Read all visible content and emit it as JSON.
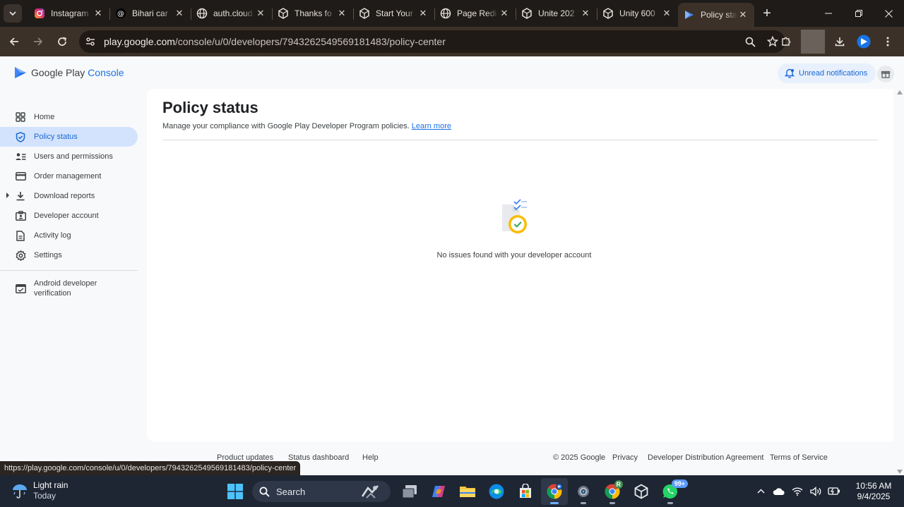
{
  "browser": {
    "tabs": [
      {
        "title": "Instagram",
        "icon": "instagram-icon",
        "active": false
      },
      {
        "title": "Bihari car",
        "icon": "threads-icon",
        "active": false
      },
      {
        "title": "auth.cloud",
        "icon": "globe-icon",
        "active": false
      },
      {
        "title": "Thanks fo",
        "icon": "unity-icon",
        "active": false
      },
      {
        "title": "Start Your",
        "icon": "unity-icon",
        "active": false
      },
      {
        "title": "Page Redi",
        "icon": "globe-icon",
        "active": false
      },
      {
        "title": "Unite 202",
        "icon": "unity-icon",
        "active": false
      },
      {
        "title": "Unity 600",
        "icon": "unity-icon",
        "active": false
      },
      {
        "title": "Policy stat",
        "icon": "play-console-icon",
        "active": true
      }
    ],
    "url_domain": "play.google.com",
    "url_path": "/console/u/0/developers/7943262549569181483/policy-center",
    "status_url": "https://play.google.com/console/u/0/developers/7943262549569181483/policy-center"
  },
  "header": {
    "logo_text_a": "Google Play",
    "logo_text_b": " Console",
    "notifications_label": "Unread notifications"
  },
  "sidebar": {
    "items": [
      {
        "label": "Home",
        "icon": "home-grid-icon"
      },
      {
        "label": "Policy status",
        "icon": "shield-check-icon"
      },
      {
        "label": "Users and permissions",
        "icon": "users-icon"
      },
      {
        "label": "Order management",
        "icon": "credit-card-icon"
      },
      {
        "label": "Download reports",
        "icon": "download-icon"
      },
      {
        "label": "Developer account",
        "icon": "id-badge-icon"
      },
      {
        "label": "Activity log",
        "icon": "document-icon"
      },
      {
        "label": "Settings",
        "icon": "gear-icon"
      },
      {
        "label": "Android developer verification",
        "icon": "verification-icon"
      }
    ]
  },
  "main": {
    "title": "Policy status",
    "description": "Manage your compliance with Google Play Developer Program policies.",
    "learn_more": "Learn more",
    "empty_message": "No issues found with your developer account"
  },
  "footer": {
    "links": [
      "Product updates",
      "Status dashboard",
      "Help"
    ],
    "copyright": "© 2025 Google",
    "legal": [
      "Privacy",
      "Developer Distribution Agreement",
      "Terms of Service"
    ]
  },
  "taskbar": {
    "weather_title": "Light rain",
    "weather_sub": "Today",
    "search_label": "Search",
    "whatsapp_badge": "99+",
    "chrome_profile_badge": "R",
    "time": "10:56 AM",
    "date": "9/4/2025"
  },
  "colors": {
    "accent": "#1a73e8",
    "active_nav_bg": "#d3e3fd",
    "chrome_frame": "#1f1b18",
    "chrome_toolbar": "#3b3128",
    "taskbar": "#1e2633"
  }
}
